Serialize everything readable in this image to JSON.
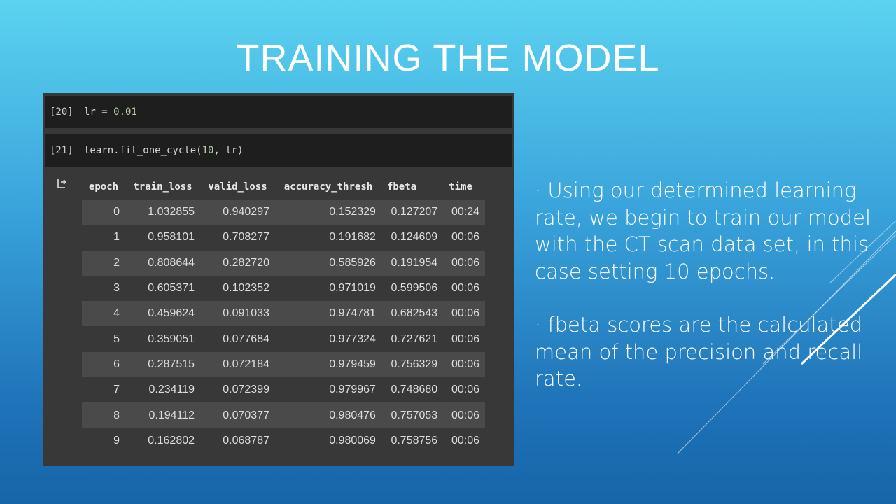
{
  "slide": {
    "title": "TRAINING THE MODEL",
    "bullets": [
      "· Using our determined learning rate, we begin to train our model with the CT scan data set, in this case setting 10 epochs.",
      "· fbeta scores are the calculated mean of the precision and recall rate."
    ]
  },
  "notebook": {
    "cell1": {
      "prompt": "[20]",
      "code_prefix": "lr = ",
      "code_number": "0.01"
    },
    "cell2": {
      "prompt": "[21]",
      "code_prefix": "learn.fit_one_cycle(",
      "code_number": "10",
      "code_suffix": ", lr)"
    },
    "output_icon": "output-arrow-icon",
    "table": {
      "headers": [
        "epoch",
        "train_loss",
        "valid_loss",
        "accuracy_thresh",
        "fbeta",
        "time"
      ],
      "rows": [
        [
          "0",
          "1.032855",
          "0.940297",
          "0.152329",
          "0.127207",
          "00:24"
        ],
        [
          "1",
          "0.958101",
          "0.708277",
          "0.191682",
          "0.124609",
          "00:06"
        ],
        [
          "2",
          "0.808644",
          "0.282720",
          "0.585926",
          "0.191954",
          "00:06"
        ],
        [
          "3",
          "0.605371",
          "0.102352",
          "0.971019",
          "0.599506",
          "00:06"
        ],
        [
          "4",
          "0.459624",
          "0.091033",
          "0.974781",
          "0.682543",
          "00:06"
        ],
        [
          "5",
          "0.359051",
          "0.077684",
          "0.977324",
          "0.727621",
          "00:06"
        ],
        [
          "6",
          "0.287515",
          "0.072184",
          "0.979459",
          "0.756329",
          "00:06"
        ],
        [
          "7",
          "0.234119",
          "0.072399",
          "0.979967",
          "0.748680",
          "00:06"
        ],
        [
          "8",
          "0.194112",
          "0.070377",
          "0.980476",
          "0.757053",
          "00:06"
        ],
        [
          "9",
          "0.162802",
          "0.068787",
          "0.980069",
          "0.758756",
          "00:06"
        ]
      ]
    }
  },
  "colors": {
    "background_top": "#5cd3f0",
    "background_bottom": "#1665a8",
    "cell_background": "#1e1e1e",
    "output_background": "#383838",
    "number_literal": "#b5cea8"
  }
}
